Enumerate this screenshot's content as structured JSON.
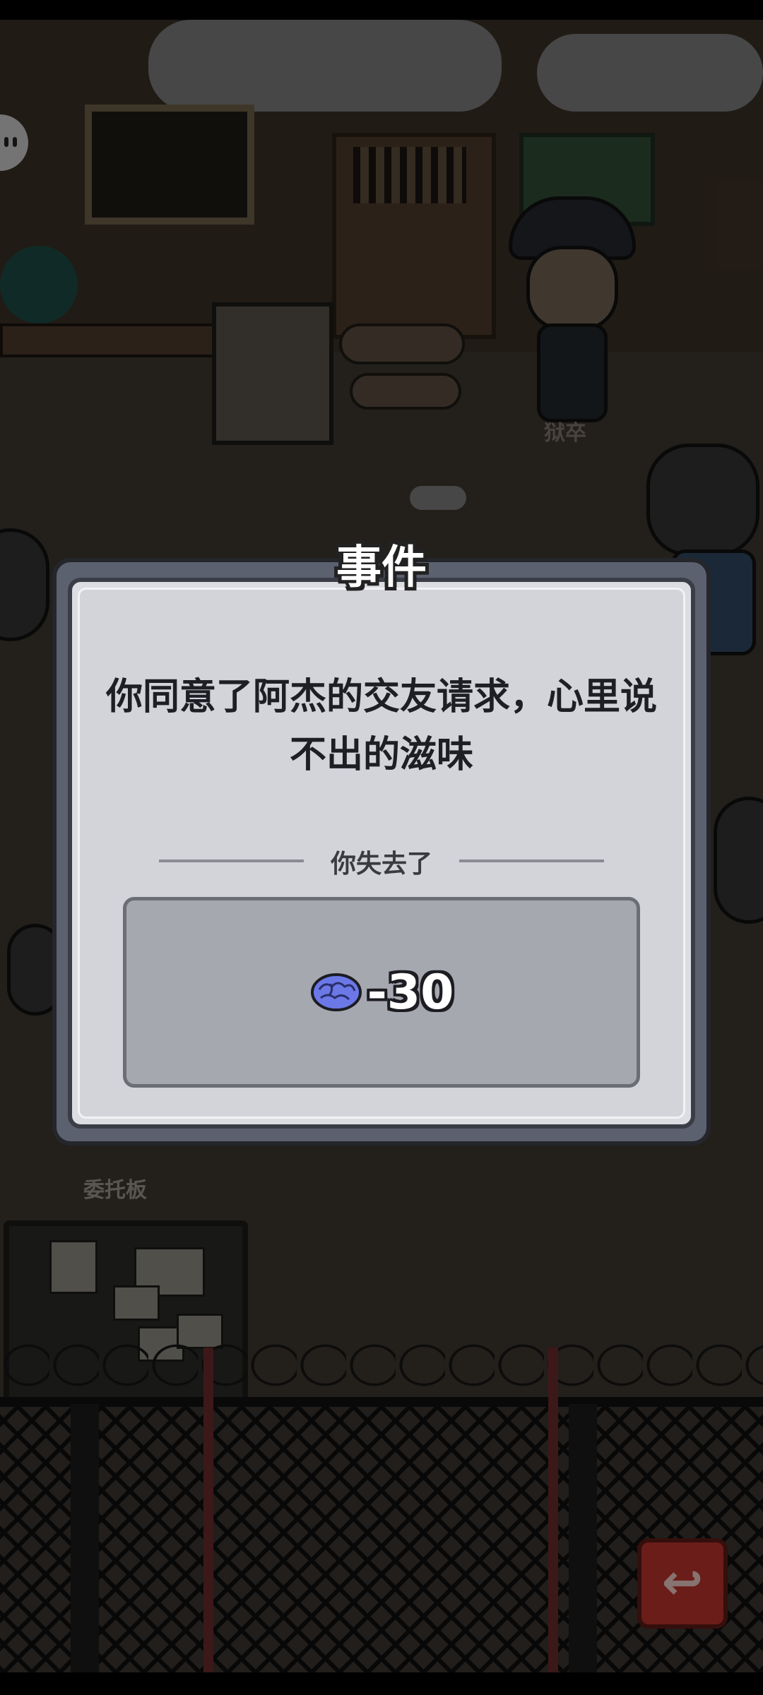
{
  "scene": {
    "guard_label": "狱卒",
    "notice_board_label": "委托板"
  },
  "dialog": {
    "title": "事件",
    "message": "你同意了阿杰的交友请求，心里说不出的滋味",
    "section_label": "你失去了",
    "reward": {
      "icon": "brain-icon",
      "value": "-30"
    }
  },
  "colors": {
    "dialog_frame": "#5c6170",
    "dialog_panel": "#d3d4da",
    "reward_box": "#a6a8b0",
    "brain": "#6b78e6",
    "back_button": "#b8322b"
  },
  "buttons": {
    "back_icon": "back-arrow-icon"
  }
}
